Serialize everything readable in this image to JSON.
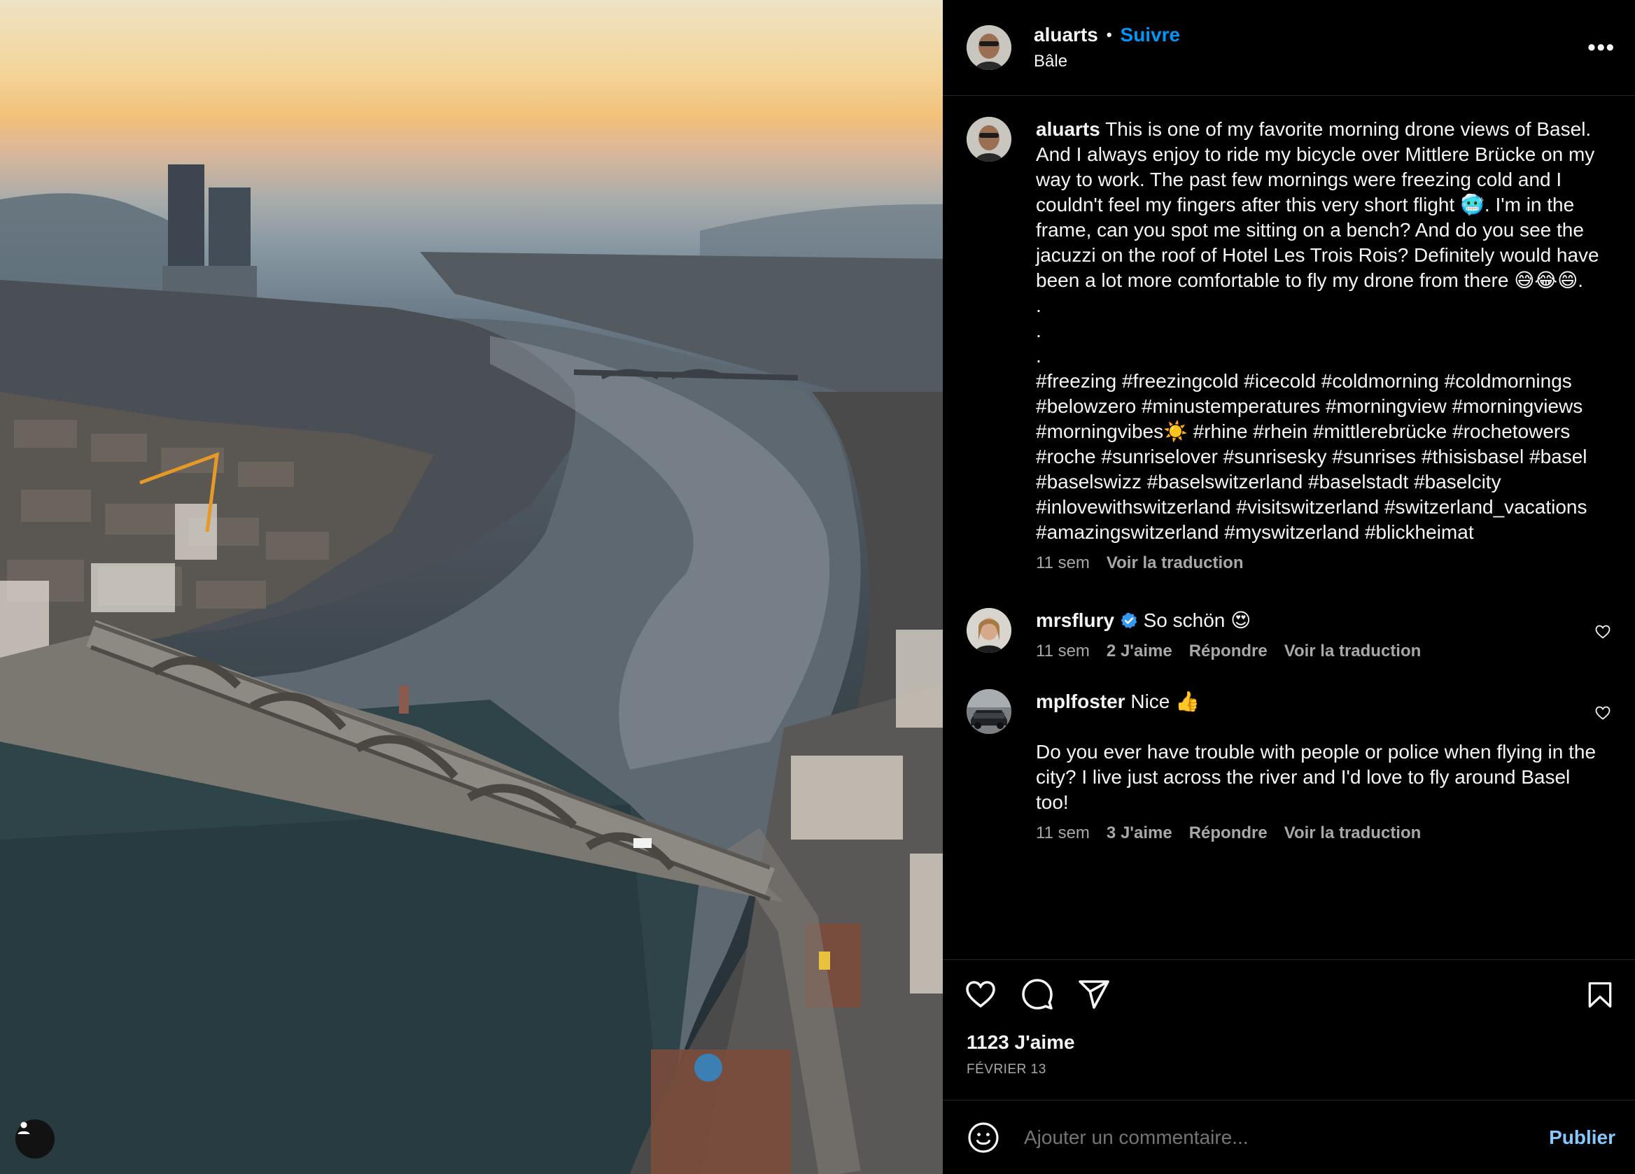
{
  "post": {
    "author": "aluarts",
    "separator": "•",
    "follow_label": "Suivre",
    "location": "Bâle",
    "more_label": "•••"
  },
  "caption": {
    "username": "aluarts",
    "text": "This is one of my favorite morning drone views of Basel. And I always enjoy to ride my bicycle over Mittlere Brücke on my way to work. The past few mornings were freezing cold and I couldn't feel my fingers after this very short flight 🥶. I'm in the frame, can you spot me sitting on a bench? And do you see the jacuzzi on the roof of Hotel Les Trois Rois? Definitely would have been a lot more comfortable to fly my drone from there 😅😂😄.\n.\n.\n.\n#freezing #freezingcold #icecold #coldmorning #coldmornings #belowzero #minustemperatures #morningview #morningviews #morningvibes☀️ #rhine #rhein #mittlerebrücke #rochetowers #roche #sunriselover #sunrisesky #sunrises #thisisbasel #basel #baselswizz #baselswitzerland #baselstadt #baselcity #inlovewithswitzerland #visitswitzerland #switzerland_vacations #amazingswitzerland #myswitzerland #blickheimat",
    "time": "11 sem",
    "translate": "Voir la traduction"
  },
  "comments": [
    {
      "username": "mrsflury",
      "verified": true,
      "text": "So schön 😍",
      "time": "11 sem",
      "likes": "2 J'aime",
      "reply": "Répondre",
      "translate": "Voir la traduction"
    },
    {
      "username": "mplfoster",
      "verified": false,
      "text": "Nice 👍\n\nDo you ever have trouble with people or police when flying in the city? I live just across the river and I'd love to fly around Basel too!",
      "time": "11 sem",
      "likes": "3 J'aime",
      "reply": "Répondre",
      "translate": "Voir la traduction"
    }
  ],
  "stats": {
    "likes": "1123 J'aime",
    "date": "FÉVRIER 13"
  },
  "composer": {
    "placeholder": "Ajouter un commentaire...",
    "publish_label": "Publier"
  },
  "colors": {
    "accent": "#0095f6",
    "publish": "#85c8ff",
    "muted": "#a8a8a8",
    "verified": "#3897f0"
  },
  "icons": {
    "like": "heart-icon",
    "comment": "comment-icon",
    "share": "send-icon",
    "save": "bookmark-icon",
    "emoji": "emoji-icon",
    "tagged_user": "user-icon",
    "options": "more-icon"
  }
}
